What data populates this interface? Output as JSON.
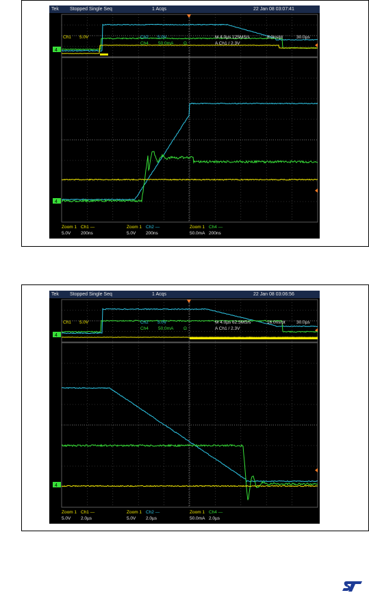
{
  "screens": [
    {
      "status": {
        "brand": "Tek",
        "state": "Stopped  Single Seq",
        "acqs": "1 Acqs",
        "datetime": "22 Jan 08 03:07:41"
      },
      "settings": {
        "ch1": "Ch1",
        "ch1_scale": "5.0V",
        "ch2": "Ch2",
        "ch2_scale": "5.0V",
        "ch4": "Ch4",
        "ch4_scale": "50.0mA",
        "omega": "Ω",
        "timebase": "M 4.0µs 125MS/s",
        "res": "8.0ns/pt",
        "delay": "30.0µs",
        "trigger": "A  Ch1  /  2.3V"
      },
      "zoom": [
        {
          "name": "Zoom 1",
          "ch": "Ch1",
          "scale": "5.0V",
          "time": "200ns"
        },
        {
          "name": "Zoom 1",
          "ch": "Ch2",
          "scale": "5.0V",
          "time": "200ns"
        },
        {
          "name": "Zoom 1",
          "ch": "Ch4",
          "scale": "50.0mA",
          "time": "200ns"
        }
      ],
      "markers": {
        "ch_marker": "4"
      }
    },
    {
      "status": {
        "brand": "Tek",
        "state": "Stopped  Single Seq",
        "acqs": "1 Acqs",
        "datetime": "22 Jan 08 03:06:56"
      },
      "settings": {
        "ch1": "Ch1",
        "ch1_scale": "5.0V",
        "ch2": "Ch2",
        "ch2_scale": "5.0V",
        "ch4": "Ch4",
        "ch4_scale": "50.0mA",
        "omega": "Ω",
        "timebase": "M 4.0µs 62.5MS/s",
        "res": "16.0ns/pt",
        "delay": "30.0µs",
        "trigger": "A  Ch1  /  2.3V"
      },
      "zoom": [
        {
          "name": "Zoom 1",
          "ch": "Ch1",
          "scale": "5.0V",
          "time": "2.0µs"
        },
        {
          "name": "Zoom 1",
          "ch": "Ch2",
          "scale": "5.0V",
          "time": "2.0µs"
        },
        {
          "name": "Zoom 1",
          "ch": "Ch4",
          "scale": "50.0mA",
          "time": "2.0µs"
        }
      ],
      "markers": {
        "ch_marker": "4"
      }
    }
  ],
  "colors": {
    "ch1": "#f2e800",
    "ch2": "#2ec8e8",
    "ch4": "#38e038",
    "grid": "#5a5a5a",
    "bar": "#1a2a4a",
    "text": "#e8e8e8",
    "orange": "#ff7a20"
  },
  "logo_icon": "st-logo-icon",
  "chart_data": [
    {
      "type": "line",
      "title": "",
      "series": [
        {
          "name": "Ch1",
          "trace": "flat",
          "level": "low"
        },
        {
          "name": "Ch2",
          "trace": "ramp-up",
          "level": "rise"
        },
        {
          "name": "Ch4",
          "trace": "step-with-ringing",
          "level": "rise"
        }
      ]
    },
    {
      "type": "line",
      "title": "",
      "series": [
        {
          "name": "Ch1",
          "trace": "flat",
          "level": "low"
        },
        {
          "name": "Ch2",
          "trace": "ramp-down",
          "level": "fall"
        },
        {
          "name": "Ch4",
          "trace": "step-down-with-ringing",
          "level": "fall"
        }
      ]
    }
  ]
}
